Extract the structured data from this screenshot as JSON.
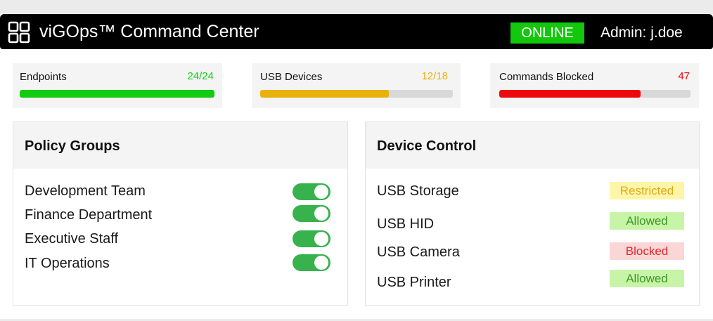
{
  "app": {
    "title": "viGOps™ Command Center",
    "status": "ONLINE",
    "user": "Admin: j.doe",
    "logo_icon": "grid-icon"
  },
  "stats": [
    {
      "label": "Endpoints",
      "value": "24/24",
      "fraction": 1.0,
      "color": "#12cc12"
    },
    {
      "label": "USB Devices",
      "value": "12/18",
      "fraction": 0.6667,
      "color": "#e8b10c"
    },
    {
      "label": "Commands Blocked",
      "value": "47",
      "fraction": 0.74,
      "color": "#ee0a0a"
    }
  ],
  "policy_groups": {
    "title": "Policy Groups",
    "items": [
      {
        "label": "Development Team",
        "enabled": true
      },
      {
        "label": "Finance Department",
        "enabled": true
      },
      {
        "label": "Executive Staff",
        "enabled": true
      },
      {
        "label": "IT Operations",
        "enabled": true
      }
    ]
  },
  "device_control": {
    "title": "Device Control",
    "items": [
      {
        "label": "USB Storage",
        "status": "Restricted",
        "text_color": "#e0a81a",
        "bg_color": "#fdf6a8"
      },
      {
        "label": "USB HID",
        "status": "Allowed",
        "text_color": "#3a9a25",
        "bg_color": "#c8f4a8"
      },
      {
        "label": "USB Camera",
        "status": "Blocked",
        "text_color": "#e0262b",
        "bg_color": "#fbd6d6"
      },
      {
        "label": "USB Printer",
        "status": "Allowed",
        "text_color": "#3a9a25",
        "bg_color": "#c8f4a8"
      }
    ]
  }
}
